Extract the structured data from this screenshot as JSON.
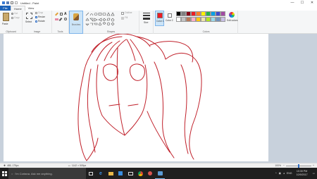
{
  "window": {
    "title": "Untitled - Paint",
    "controls": {
      "minimize": "—",
      "maximize": "☐",
      "close": "✕"
    }
  },
  "tabs": {
    "file": "File",
    "home": "Home",
    "view": "View"
  },
  "ribbon": {
    "clipboard": {
      "label": "Clipboard",
      "paste": "Paste",
      "cut": "Cut",
      "copy": "Copy"
    },
    "image": {
      "label": "Image",
      "select": "Select",
      "crop": "Crop",
      "resize": "Resize",
      "rotate": "Rotate"
    },
    "tools": {
      "label": "Tools"
    },
    "brushes": {
      "label": "Brushes"
    },
    "shapes": {
      "label": "Shapes",
      "outline": "Outline",
      "fill": "Fill"
    },
    "size": {
      "label": "Size"
    },
    "color1": {
      "label": "Color 1"
    },
    "color2": {
      "label": "Color 2"
    },
    "colors": {
      "label": "Colors",
      "edit": "Edit colors"
    },
    "accent": "#1c62b9",
    "palette": [
      "#000000",
      "#7f7f7f",
      "#880015",
      "#ed1c24",
      "#ff7f27",
      "#fff200",
      "#22b14c",
      "#00a2e8",
      "#3f48cc",
      "#a349a4",
      "#ffffff",
      "#c3c3c3",
      "#b97a57",
      "#ffaec9",
      "#ffc90e",
      "#efe4b0",
      "#b5e61d",
      "#99d9ea",
      "#7092be",
      "#c8bfe7"
    ],
    "color1_value": "#ed1c24",
    "color2_value": "#ffffff"
  },
  "drawing": {
    "stroke": "#c0202a"
  },
  "status": {
    "cursor": "485, 175px",
    "canvas_size": "1142 × 509px",
    "zoom": "100%"
  },
  "taskbar": {
    "search_placeholder": "I'm Cortana. Ask me anything.",
    "language": "ENG",
    "time": "10:30 PM",
    "date": "10/9/2017"
  }
}
